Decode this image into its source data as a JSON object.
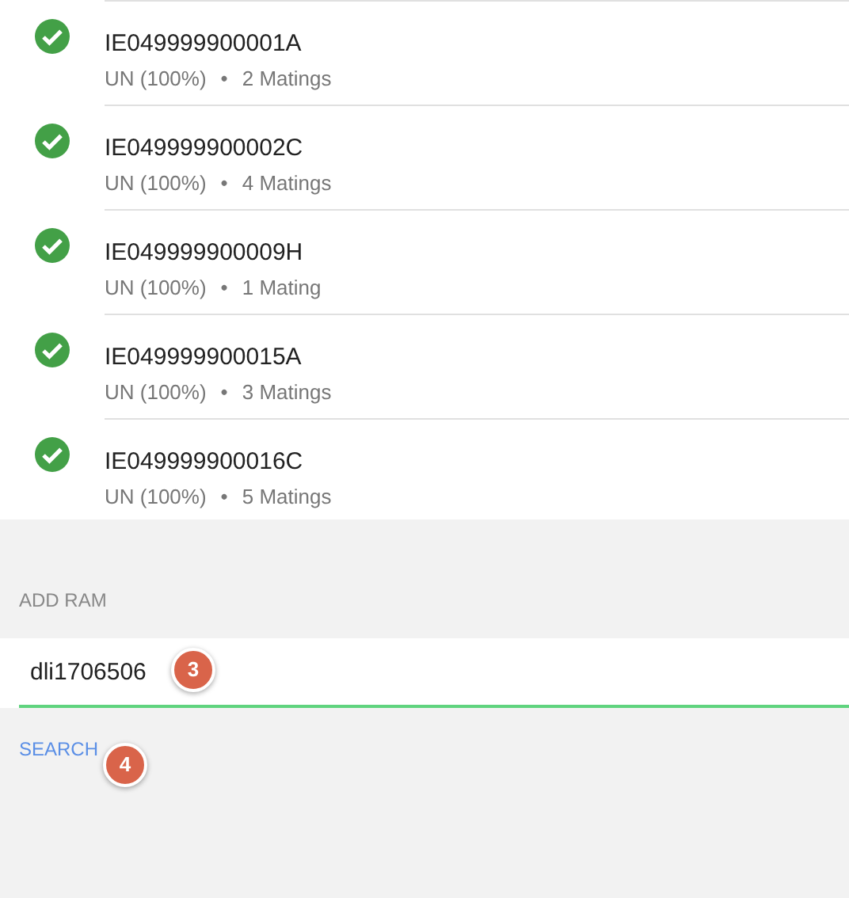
{
  "rams": [
    {
      "tag": "IE049999900001A",
      "breed": "UN (100%)",
      "separator": "•",
      "matings": "2 Matings",
      "checked": true
    },
    {
      "tag": "IE049999900002C",
      "breed": "UN (100%)",
      "separator": "•",
      "matings": "4 Matings",
      "checked": true
    },
    {
      "tag": "IE049999900009H",
      "breed": "UN (100%)",
      "separator": "•",
      "matings": "1 Mating",
      "checked": true
    },
    {
      "tag": "IE049999900015A",
      "breed": "UN (100%)",
      "separator": "•",
      "matings": "3 Matings",
      "checked": true
    },
    {
      "tag": "IE049999900016C",
      "breed": "UN (100%)",
      "separator": "•",
      "matings": "5 Matings",
      "checked": true
    }
  ],
  "add_ram": {
    "label": "ADD RAM",
    "value": "dli1706506",
    "field_marker": "3",
    "search": "SEARCH",
    "search_marker": "4"
  }
}
